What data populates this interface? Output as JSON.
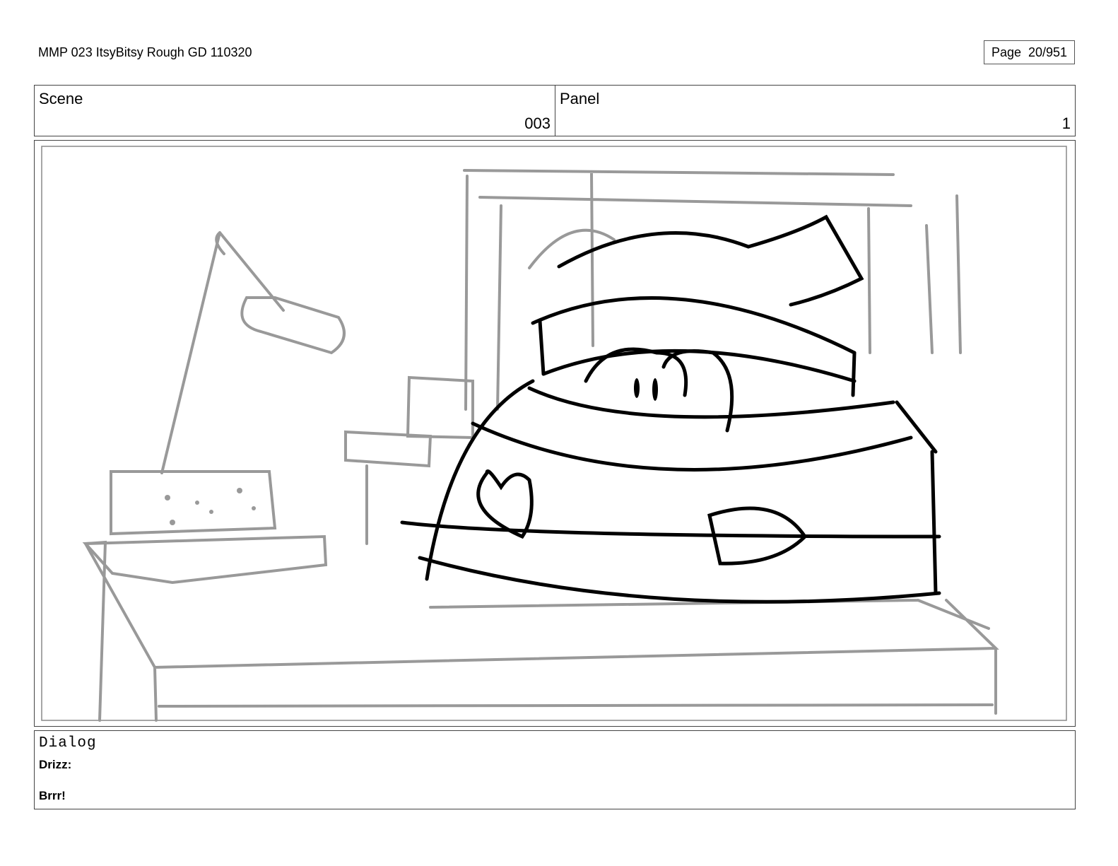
{
  "document": {
    "title": "MMP 023 ItsyBitsy Rough GD 110320",
    "page_label": "Page  20/951"
  },
  "header": {
    "scene_label": "Scene",
    "scene_value": "003",
    "panel_label": "Panel",
    "panel_value": "1"
  },
  "dialog": {
    "label": "Dialog",
    "speaker": "Drizz:",
    "line": "Brrr!"
  },
  "colors": {
    "sketch_gray": "#999999",
    "ink_black": "#000000",
    "border": "#444444"
  }
}
